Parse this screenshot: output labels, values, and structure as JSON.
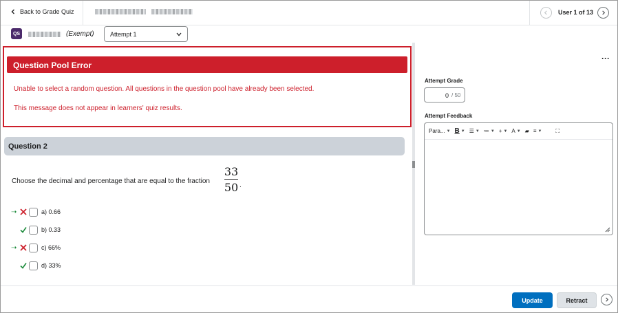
{
  "header": {
    "back_label": "Back to Grade Quiz",
    "user_count": "User 1 of 13"
  },
  "subbar": {
    "badge": "QS",
    "exempt": "(Exempt)",
    "attempt": "Attempt 1"
  },
  "error": {
    "title": "Question Pool Error",
    "message": "Unable to select a random question. All questions in the question pool have already been selected.",
    "note": "This message does not appear in learners' quiz results."
  },
  "question": {
    "title": "Question 2",
    "text": "Choose the decimal and percentage that are equal to the fraction",
    "fraction_numerator": "33",
    "fraction_denominator": "50",
    "options": [
      {
        "label": "a) 0.66",
        "selected": true,
        "correct": false
      },
      {
        "label": "b) 0.33",
        "selected": false,
        "correct": true
      },
      {
        "label": "c) 66%",
        "selected": true,
        "correct": false
      },
      {
        "label": "d) 33%",
        "selected": false,
        "correct": true
      }
    ]
  },
  "grading": {
    "grade_label": "Attempt Grade",
    "grade_value": "0",
    "grade_out_of": "/ 50",
    "feedback_label": "Attempt Feedback",
    "toolbar_format": "Para..."
  },
  "footer": {
    "update": "Update",
    "retract": "Retract"
  },
  "colors": {
    "error_red": "#cd1f2b",
    "primary_blue": "#006fbf",
    "correct_green": "#1b8a3a"
  }
}
